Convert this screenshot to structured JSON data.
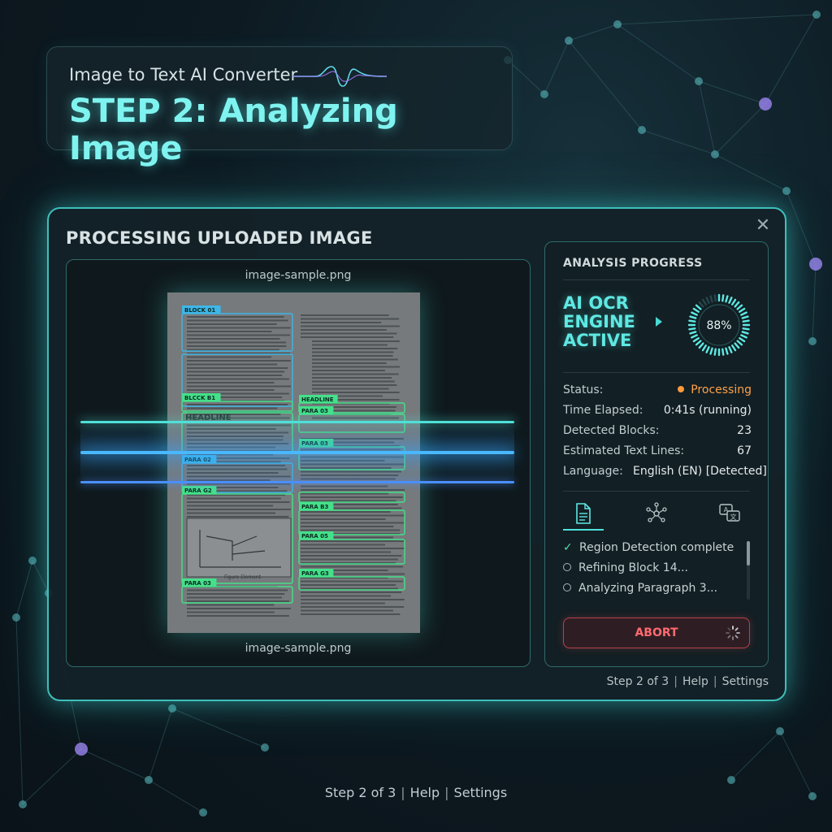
{
  "header": {
    "app_name": "Image to Text AI Converter",
    "step_title": "STEP 2: Analyzing Image"
  },
  "panel": {
    "title": "PROCESSING UPLOADED IMAGE",
    "close_icon": "close-icon",
    "viewer": {
      "filename_top": "image-sample.png",
      "filename_bottom": "image-sample.png",
      "block_labels": [
        "BLOCK 01",
        "BLCCK B1",
        "HEADLINE",
        "PARA 02",
        "PARA G2",
        "PARA 03",
        "HEADLINE",
        "PARA 03",
        "PARA 03",
        "PARA B3",
        "PARA 05",
        "PARA G3"
      ],
      "headline_text": "HEADLINE",
      "figure_caption": "Figure Element"
    },
    "footer": {
      "step": "Step 2 of 3",
      "help": "Help",
      "settings": "Settings"
    }
  },
  "progress": {
    "title": "ANALYSIS PROGRESS",
    "engine_lines": [
      "AI OCR",
      "ENGINE",
      "ACTIVE"
    ],
    "percent": 88,
    "percent_label": "88%",
    "stats": {
      "status_label": "Status:",
      "status_value": "Processing",
      "time_label": "Time Elapsed:",
      "time_value": "0:41s (running)",
      "blocks_label": "Detected Blocks:",
      "blocks_value": "23",
      "lines_label": "Estimated Text Lines:",
      "lines_value": "67",
      "language_label": "Language:",
      "language_value": "English (EN) [Detected]"
    },
    "tabs": [
      "document-icon",
      "network-icon",
      "translate-icon"
    ],
    "tasks": [
      {
        "label": "Region Detection complete",
        "done": true
      },
      {
        "label": "Refining Block 14...",
        "done": false
      },
      {
        "label": "Analyzing Paragraph 3...",
        "done": false
      }
    ],
    "abort_label": "ABORT"
  },
  "page_footer": {
    "step": "Step 2 of 3",
    "help": "Help",
    "settings": "Settings"
  },
  "colors": {
    "accent": "#5ee9e3",
    "status_orange": "#ffa24a",
    "abort_red": "#ff6a6e",
    "block_blue": "#3fb6e8",
    "block_green": "#45e08a"
  }
}
